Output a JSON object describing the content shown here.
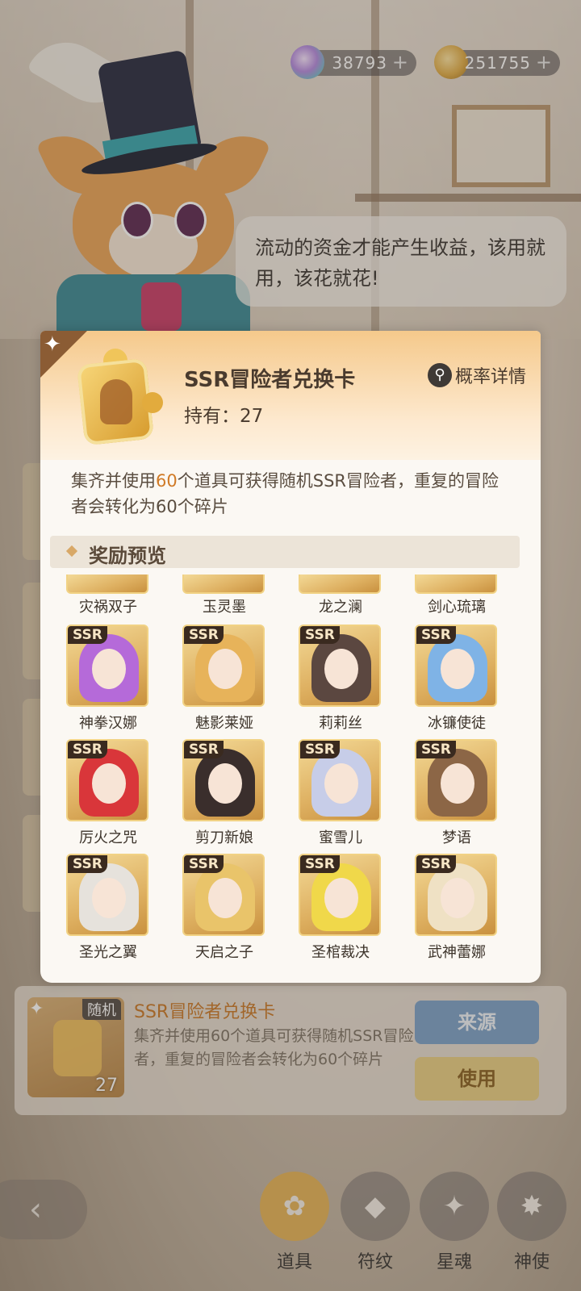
{
  "currency": [
    {
      "icon": "crystal-icon",
      "value": "38793",
      "plus": "+"
    },
    {
      "icon": "paw-coin-icon",
      "value": "251755",
      "plus": "+"
    }
  ],
  "speech": "流动的资金才能产生收益，该用就用，该花就花!",
  "modal": {
    "item_name": "SSR冒险者兑换卡",
    "own_label": "持有：27",
    "prob_label": "概率详情",
    "desc_before": "集齐并使用",
    "desc_highlight": "60",
    "desc_after": "个道具可获得随机SSR冒险者，重复的冒险者会转化为60个碎片",
    "reward_title": "奖励预览",
    "ssr_tag": "SSR",
    "top_row": [
      "灾祸双子",
      "玉灵墨",
      "龙之澜",
      "剑心琉璃"
    ],
    "characters": [
      {
        "name": "神拳汉娜",
        "hair": "#b56ad9"
      },
      {
        "name": "魅影莱娅",
        "hair": "#e7b35a"
      },
      {
        "name": "莉莉丝",
        "hair": "#5b4740"
      },
      {
        "name": "冰镰使徒",
        "hair": "#7fb3e6"
      },
      {
        "name": "厉火之咒",
        "hair": "#d9363a"
      },
      {
        "name": "剪刀新娘",
        "hair": "#3a2e2c"
      },
      {
        "name": "蜜雪儿",
        "hair": "#c7cde8"
      },
      {
        "name": "梦语",
        "hair": "#8c6646"
      },
      {
        "name": "圣光之翼",
        "hair": "#e6e2dc"
      },
      {
        "name": "天启之子",
        "hair": "#e9c46a"
      },
      {
        "name": "圣棺裁决",
        "hair": "#f0d84a"
      },
      {
        "name": "武神蕾娜",
        "hair": "#efe1c4"
      }
    ]
  },
  "detail": {
    "tag": "随机",
    "count": "27",
    "title": "SSR冒险者兑换卡",
    "desc": "集齐并使用60个道具可获得随机SSR冒险者，重复的冒险者会转化为60个碎片",
    "source_label": "来源",
    "use_label": "使用"
  },
  "nav": {
    "back": "‹",
    "items": [
      {
        "label": "道具",
        "icon": "bag-icon",
        "glyph": "✿",
        "active": true
      },
      {
        "label": "符纹",
        "icon": "dice-icon",
        "glyph": "◆",
        "active": false
      },
      {
        "label": "星魂",
        "icon": "card-icon",
        "glyph": "✦",
        "active": false
      },
      {
        "label": "神使",
        "icon": "star-burst-icon",
        "glyph": "✸",
        "active": false
      }
    ]
  }
}
